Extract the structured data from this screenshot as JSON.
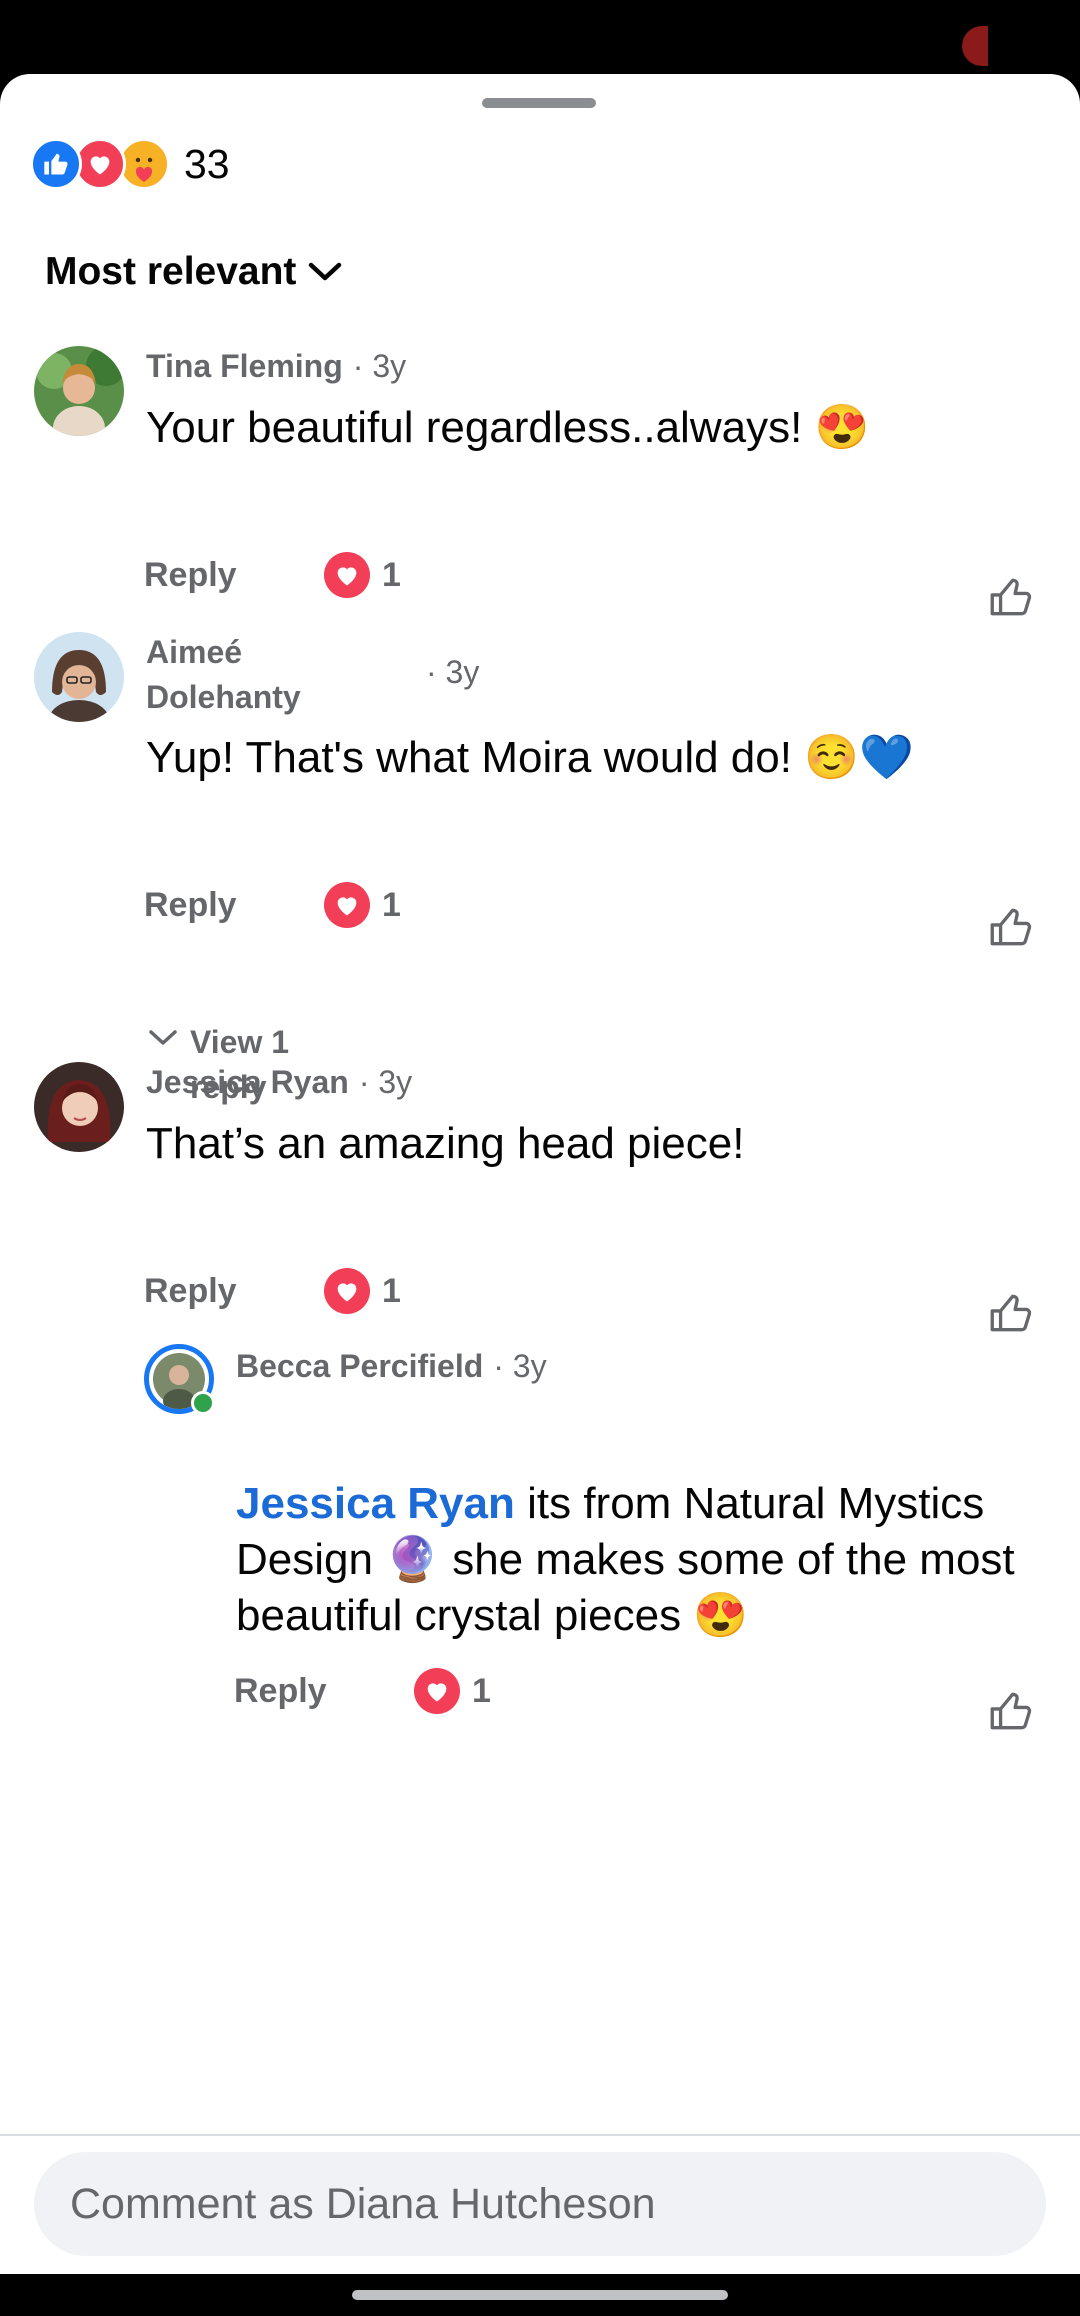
{
  "reactions": {
    "count": "33",
    "icons": [
      "like-icon",
      "love-icon",
      "care-icon"
    ]
  },
  "sort": {
    "label": "Most relevant"
  },
  "comments": [
    {
      "author": "Tina Fleming",
      "time": "· 3y",
      "text": "Your beautiful regardless..always! 😍",
      "reply_label": "Reply",
      "love_count": "1"
    },
    {
      "author_line1": "Aimeé",
      "author_line2": "Dolehanty",
      "time": "· 3y",
      "text": "Yup! That's what Moira would do! ☺️💙",
      "reply_label": "Reply",
      "love_count": "1"
    },
    {
      "author": "Jessica Ryan",
      "time": "· 3y",
      "text": "That’s an amazing head piece!",
      "reply_label": "Reply",
      "love_count": "1"
    }
  ],
  "view_replies": {
    "line1": "View 1",
    "line2": "reply"
  },
  "reply": {
    "author": "Becca Percifield",
    "time": "· 3y",
    "mention": "Jessica Ryan",
    "text_line1": " its from Natural Mystics",
    "text_line2": "Design 🔮  she makes some of the most",
    "text_line3": "beautiful crystal pieces 😍",
    "reply_label": "Reply",
    "love_count": "1"
  },
  "composer": {
    "placeholder": "Comment as Diana Hutcheson"
  },
  "colors": {
    "like": "#1877f2",
    "love": "#f33e58",
    "mention": "#1b6ad6",
    "muted": "#65676b"
  }
}
